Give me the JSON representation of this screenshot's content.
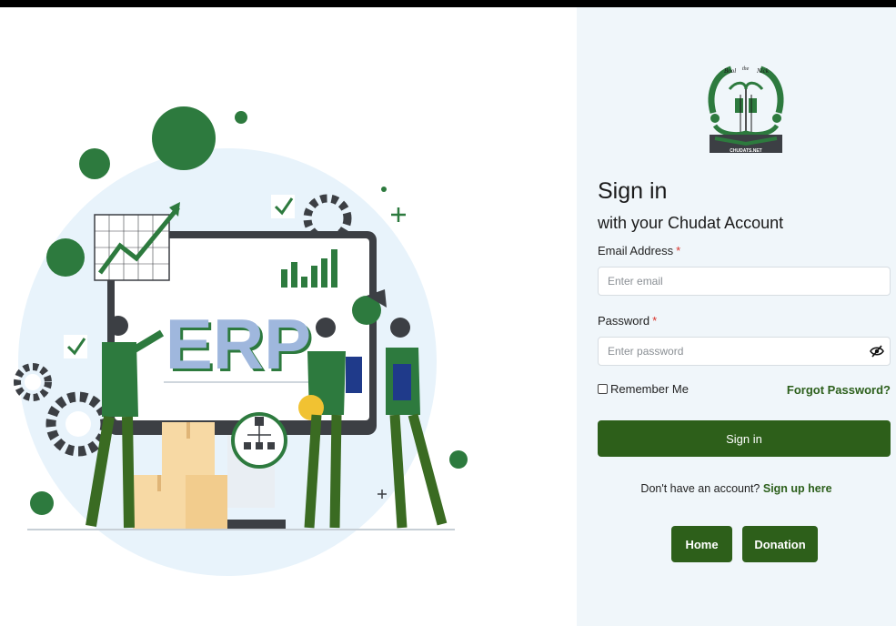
{
  "illustration": {
    "screen_text": "ERP",
    "colors": {
      "primary_green": "#2d7a3e",
      "dark_green": "#2d5f1a",
      "light_blue": "#e8f3fb",
      "box": "#f7d9a4",
      "gray": "#3c3f44"
    }
  },
  "logo": {
    "arc_text_left": "Bool",
    "arc_text_mid": "the",
    "arc_text_right": "Nick",
    "bottom_text": "CHUDATS.NET"
  },
  "form": {
    "title": "Sign in",
    "subtitle": "with your Chudat Account",
    "email_label": "Email Address",
    "email_required": "*",
    "email_placeholder": "Enter email",
    "password_label": "Password",
    "password_required": "*",
    "password_placeholder": "Enter password",
    "remember_label": "Remember Me",
    "forgot_label": "Forgot Password?",
    "signin_label": "Sign in",
    "signup_prompt": "Don't have an account?",
    "signup_link": "Sign up here",
    "home_label": "Home",
    "donation_label": "Donation"
  },
  "colors": {
    "accent": "#2d5f1a",
    "panel_bg": "#f0f6fa",
    "required": "#d9342b"
  }
}
